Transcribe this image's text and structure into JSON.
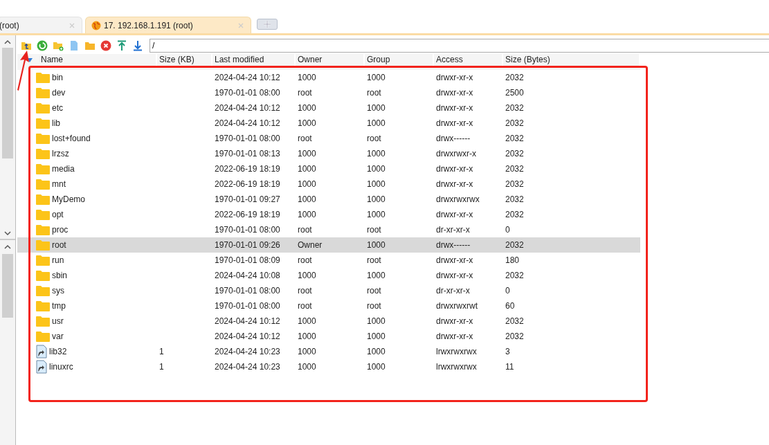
{
  "tabs": [
    {
      "label": "(root)",
      "selected": false
    },
    {
      "label": "17. 192.168.1.191 (root)",
      "selected": true
    }
  ],
  "path_field": {
    "value": "/"
  },
  "table": {
    "columns": [
      "Name",
      "Size (KB)",
      "Last modified",
      "Owner",
      "Group",
      "Access",
      "Size (Bytes)"
    ],
    "rows": [
      {
        "kind": "folder",
        "selected": false,
        "cells": [
          "bin",
          "",
          "2024-04-24 10:12",
          "1000",
          "1000",
          "drwxr-xr-x",
          "2032"
        ]
      },
      {
        "kind": "folder",
        "selected": false,
        "cells": [
          "dev",
          "",
          "1970-01-01 08:00",
          "root",
          "root",
          "drwxr-xr-x",
          "2500"
        ]
      },
      {
        "kind": "folder",
        "selected": false,
        "cells": [
          "etc",
          "",
          "2024-04-24 10:12",
          "1000",
          "1000",
          "drwxr-xr-x",
          "2032"
        ]
      },
      {
        "kind": "folder",
        "selected": false,
        "cells": [
          "lib",
          "",
          "2024-04-24 10:12",
          "1000",
          "1000",
          "drwxr-xr-x",
          "2032"
        ]
      },
      {
        "kind": "folder",
        "selected": false,
        "cells": [
          "lost+found",
          "",
          "1970-01-01 08:00",
          "root",
          "root",
          "drwx------",
          "2032"
        ]
      },
      {
        "kind": "folder",
        "selected": false,
        "cells": [
          "lrzsz",
          "",
          "1970-01-01 08:13",
          "1000",
          "1000",
          "drwxrwxr-x",
          "2032"
        ]
      },
      {
        "kind": "folder",
        "selected": false,
        "cells": [
          "media",
          "",
          "2022-06-19 18:19",
          "1000",
          "1000",
          "drwxr-xr-x",
          "2032"
        ]
      },
      {
        "kind": "folder",
        "selected": false,
        "cells": [
          "mnt",
          "",
          "2022-06-19 18:19",
          "1000",
          "1000",
          "drwxr-xr-x",
          "2032"
        ]
      },
      {
        "kind": "folder",
        "selected": false,
        "cells": [
          "MyDemo",
          "",
          "1970-01-01 09:27",
          "1000",
          "1000",
          "drwxrwxrwx",
          "2032"
        ]
      },
      {
        "kind": "folder",
        "selected": false,
        "cells": [
          "opt",
          "",
          "2022-06-19 18:19",
          "1000",
          "1000",
          "drwxr-xr-x",
          "2032"
        ]
      },
      {
        "kind": "folder",
        "selected": false,
        "cells": [
          "proc",
          "",
          "1970-01-01 08:00",
          "root",
          "root",
          "dr-xr-xr-x",
          "0"
        ]
      },
      {
        "kind": "folder",
        "selected": true,
        "cells": [
          "root",
          "",
          "1970-01-01 09:26",
          "Owner",
          "1000",
          "drwx------",
          "2032"
        ]
      },
      {
        "kind": "folder",
        "selected": false,
        "cells": [
          "run",
          "",
          "1970-01-01 08:09",
          "root",
          "root",
          "drwxr-xr-x",
          "180"
        ]
      },
      {
        "kind": "folder",
        "selected": false,
        "cells": [
          "sbin",
          "",
          "2024-04-24 10:08",
          "1000",
          "1000",
          "drwxr-xr-x",
          "2032"
        ]
      },
      {
        "kind": "folder",
        "selected": false,
        "cells": [
          "sys",
          "",
          "1970-01-01 08:00",
          "root",
          "root",
          "dr-xr-xr-x",
          "0"
        ]
      },
      {
        "kind": "folder",
        "selected": false,
        "cells": [
          "tmp",
          "",
          "1970-01-01 08:00",
          "root",
          "root",
          "drwxrwxrwt",
          "60"
        ]
      },
      {
        "kind": "folder",
        "selected": false,
        "cells": [
          "usr",
          "",
          "2024-04-24 10:12",
          "1000",
          "1000",
          "drwxr-xr-x",
          "2032"
        ]
      },
      {
        "kind": "folder",
        "selected": false,
        "cells": [
          "var",
          "",
          "2024-04-24 10:12",
          "1000",
          "1000",
          "drwxr-xr-x",
          "2032"
        ]
      },
      {
        "kind": "link",
        "selected": false,
        "cells": [
          "lib32",
          "1",
          "2024-04-24 10:23",
          "1000",
          "1000",
          "lrwxrwxrwx",
          "3"
        ]
      },
      {
        "kind": "link",
        "selected": false,
        "cells": [
          "linuxrc",
          "1",
          "2024-04-24 10:23",
          "1000",
          "1000",
          "lrwxrwxrwx",
          "11"
        ]
      }
    ]
  }
}
